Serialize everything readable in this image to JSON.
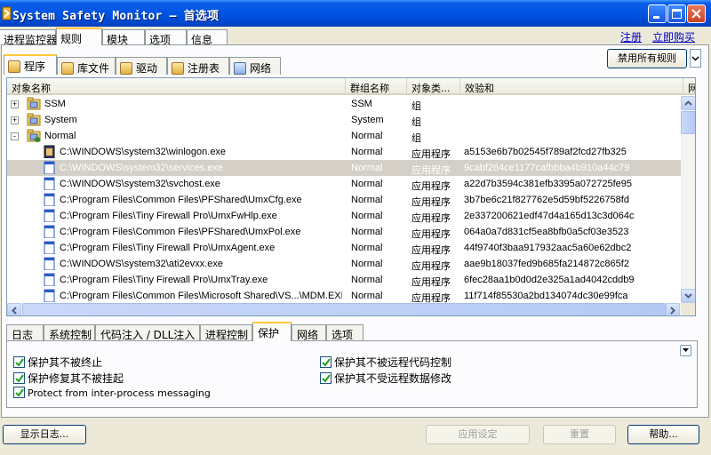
{
  "window": {
    "title": "System Safety Monitor — 首选项"
  },
  "main_tabs": [
    "进程监控器",
    "规则",
    "模块",
    "选项",
    "信息"
  ],
  "links": {
    "register": "注册",
    "buy_now": "立即购买"
  },
  "sub_tabs": [
    "程序",
    "库文件",
    "驱动",
    "注册表",
    "网络"
  ],
  "buttons": {
    "disable_all_rules": "禁用所有规则",
    "show_log": "显示日志...",
    "apply": "应用设定",
    "reset": "重置",
    "help": "帮助..."
  },
  "list": {
    "columns": [
      "对象名称",
      "群组名称",
      "对象类...",
      "效验和",
      "网"
    ],
    "rows": [
      {
        "level": 0,
        "expander": "+",
        "icon": "folder-icon",
        "name": "SSM",
        "group": "SSM",
        "type": "组",
        "checksum": "",
        "selected": false
      },
      {
        "level": 0,
        "expander": "+",
        "icon": "folder-icon",
        "name": "System",
        "group": "System",
        "type": "组",
        "checksum": "",
        "selected": false
      },
      {
        "level": 0,
        "expander": "-",
        "icon": "folder-open-icon",
        "name": "Normal",
        "group": "Normal",
        "type": "组",
        "checksum": "",
        "selected": false
      },
      {
        "level": 1,
        "expander": "",
        "icon": "app-icon",
        "name": "C:\\WINDOWS\\system32\\winlogon.exe",
        "group": "Normal",
        "type": "应用程序",
        "checksum": "a5153e6b7b02545f789af2fcd27fb325",
        "selected": false
      },
      {
        "level": 1,
        "expander": "",
        "icon": "file-icon",
        "name": "C:\\WINDOWS\\system32\\services.exe",
        "group": "Normal",
        "type": "应用程序",
        "checksum": "9cabf264ce1177cafbbba4b910a44c79",
        "selected": true
      },
      {
        "level": 1,
        "expander": "",
        "icon": "file-icon",
        "name": "C:\\WINDOWS\\system32\\svchost.exe",
        "group": "Normal",
        "type": "应用程序",
        "checksum": "a22d7b3594c381efb3395a072725fe95",
        "selected": false
      },
      {
        "level": 1,
        "expander": "",
        "icon": "file-icon",
        "name": "C:\\Program Files\\Common Files\\PFShared\\UmxCfg.exe",
        "group": "Normal",
        "type": "应用程序",
        "checksum": "3b7be6c21f827762e5d59bf5226758fd",
        "selected": false
      },
      {
        "level": 1,
        "expander": "",
        "icon": "file-icon",
        "name": "C:\\Program Files\\Tiny Firewall Pro\\UmxFwHlp.exe",
        "group": "Normal",
        "type": "应用程序",
        "checksum": "2e337200621edf47d4a165d13c3d064c",
        "selected": false
      },
      {
        "level": 1,
        "expander": "",
        "icon": "file-icon",
        "name": "C:\\Program Files\\Common Files\\PFShared\\UmxPol.exe",
        "group": "Normal",
        "type": "应用程序",
        "checksum": "064a0a7d831cf5ea8bfb0a5cf03e3523",
        "selected": false
      },
      {
        "level": 1,
        "expander": "",
        "icon": "file-icon",
        "name": "C:\\Program Files\\Tiny Firewall Pro\\UmxAgent.exe",
        "group": "Normal",
        "type": "应用程序",
        "checksum": "44f9740f3baa917932aac5a60e62dbc2",
        "selected": false
      },
      {
        "level": 1,
        "expander": "",
        "icon": "file-icon",
        "name": "C:\\WINDOWS\\system32\\ati2evxx.exe",
        "group": "Normal",
        "type": "应用程序",
        "checksum": "aae9b18037fed9b685fa214872c865f2",
        "selected": false
      },
      {
        "level": 1,
        "expander": "",
        "icon": "file-icon",
        "name": "C:\\Program Files\\Tiny Firewall Pro\\UmxTray.exe",
        "group": "Normal",
        "type": "应用程序",
        "checksum": "6fec28aa1b0d0d2e325a1ad4042cddb9",
        "selected": false
      },
      {
        "level": 1,
        "expander": "",
        "icon": "file-icon",
        "name": "C:\\Program Files\\Common Files\\Microsoft Shared\\VS...\\MDM.EXE",
        "group": "Normal",
        "type": "应用程序",
        "checksum": "11f714f85530a2bd134074dc30e99fca",
        "selected": false
      }
    ]
  },
  "bottom_tabs": [
    "日志",
    "系统控制",
    "代码注入 / DLL注入",
    "进程控制",
    "保护",
    "网络",
    "选项"
  ],
  "protection_options": [
    {
      "label": "保护其不被终止",
      "checked": true
    },
    {
      "label": "保护修复其不被挂起",
      "checked": true
    },
    {
      "label": "Protect from inter-process messaging",
      "checked": true
    },
    {
      "label": "保护其不被远程代码控制",
      "checked": true
    },
    {
      "label": "保护其不受远程数据修改",
      "checked": true
    }
  ],
  "colors": {
    "title_bar": "#0054e3",
    "tab_highlight": "#ffc73c",
    "link": "#0000cc",
    "selection": "#d4d0c8"
  }
}
